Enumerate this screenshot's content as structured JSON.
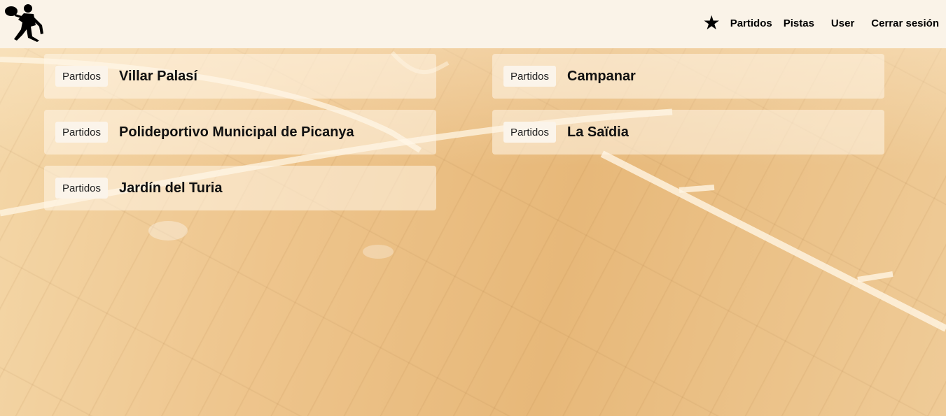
{
  "header": {
    "logo_icon": "padel-player-silhouette-icon",
    "favorites_icon": "star-icon",
    "favorites_glyph": "★",
    "nav": {
      "partidos": "Partidos",
      "pistas": "Pistas",
      "user": "User",
      "logout": "Cerrar sesión"
    }
  },
  "venues": [
    {
      "badge": "Partidos",
      "name": "Villar Palasí"
    },
    {
      "badge": "Partidos",
      "name": "Campanar"
    },
    {
      "badge": "Partidos",
      "name": "Polideportivo Municipal de Picanya"
    },
    {
      "badge": "Partidos",
      "name": "La Saïdia"
    },
    {
      "badge": "Partidos",
      "name": "Jardín del Turia"
    }
  ],
  "colors": {
    "header_bg": "#faf3e8",
    "floor": "#eec58d",
    "text": "#000000"
  }
}
